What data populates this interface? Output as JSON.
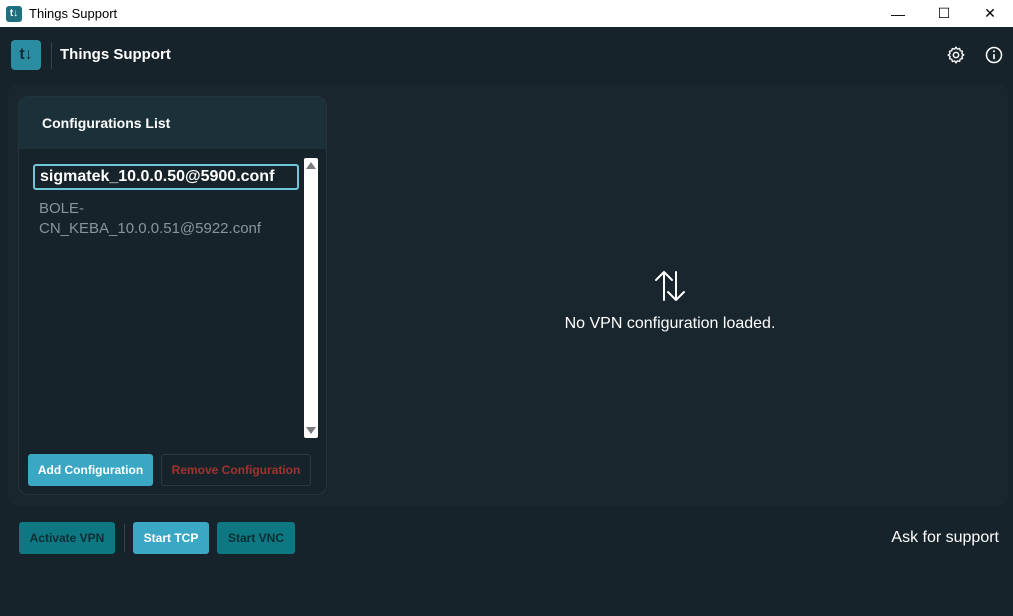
{
  "window": {
    "title": "Things Support",
    "icon_glyph": "t↓",
    "controls": {
      "minimize": "—",
      "maximize": "☐",
      "close": "✕"
    }
  },
  "header": {
    "logo_glyph": "t↓",
    "title": "Things Support",
    "icons": [
      "gear-icon",
      "info-icon"
    ]
  },
  "config_panel": {
    "title": "Configurations List",
    "items": [
      {
        "label": "sigmatek_10.0.0.50@5900.conf",
        "selected": true
      },
      {
        "label": "BOLE-CN_KEBA_10.0.0.51@5922.conf",
        "selected": false
      }
    ],
    "add_button": "Add Configuration",
    "remove_button": "Remove Configuration"
  },
  "main": {
    "icon": "transfer-arrows-icon",
    "message": "No VPN configuration loaded."
  },
  "footer": {
    "activate_vpn": "Activate VPN",
    "start_tcp": "Start TCP",
    "start_vnc": "Start VNC",
    "support": "Ask for support"
  },
  "colors": {
    "background": "#16232a",
    "accent": "#3aa8c4",
    "accent_dark": "#0e7882",
    "danger": "#a3322f"
  }
}
